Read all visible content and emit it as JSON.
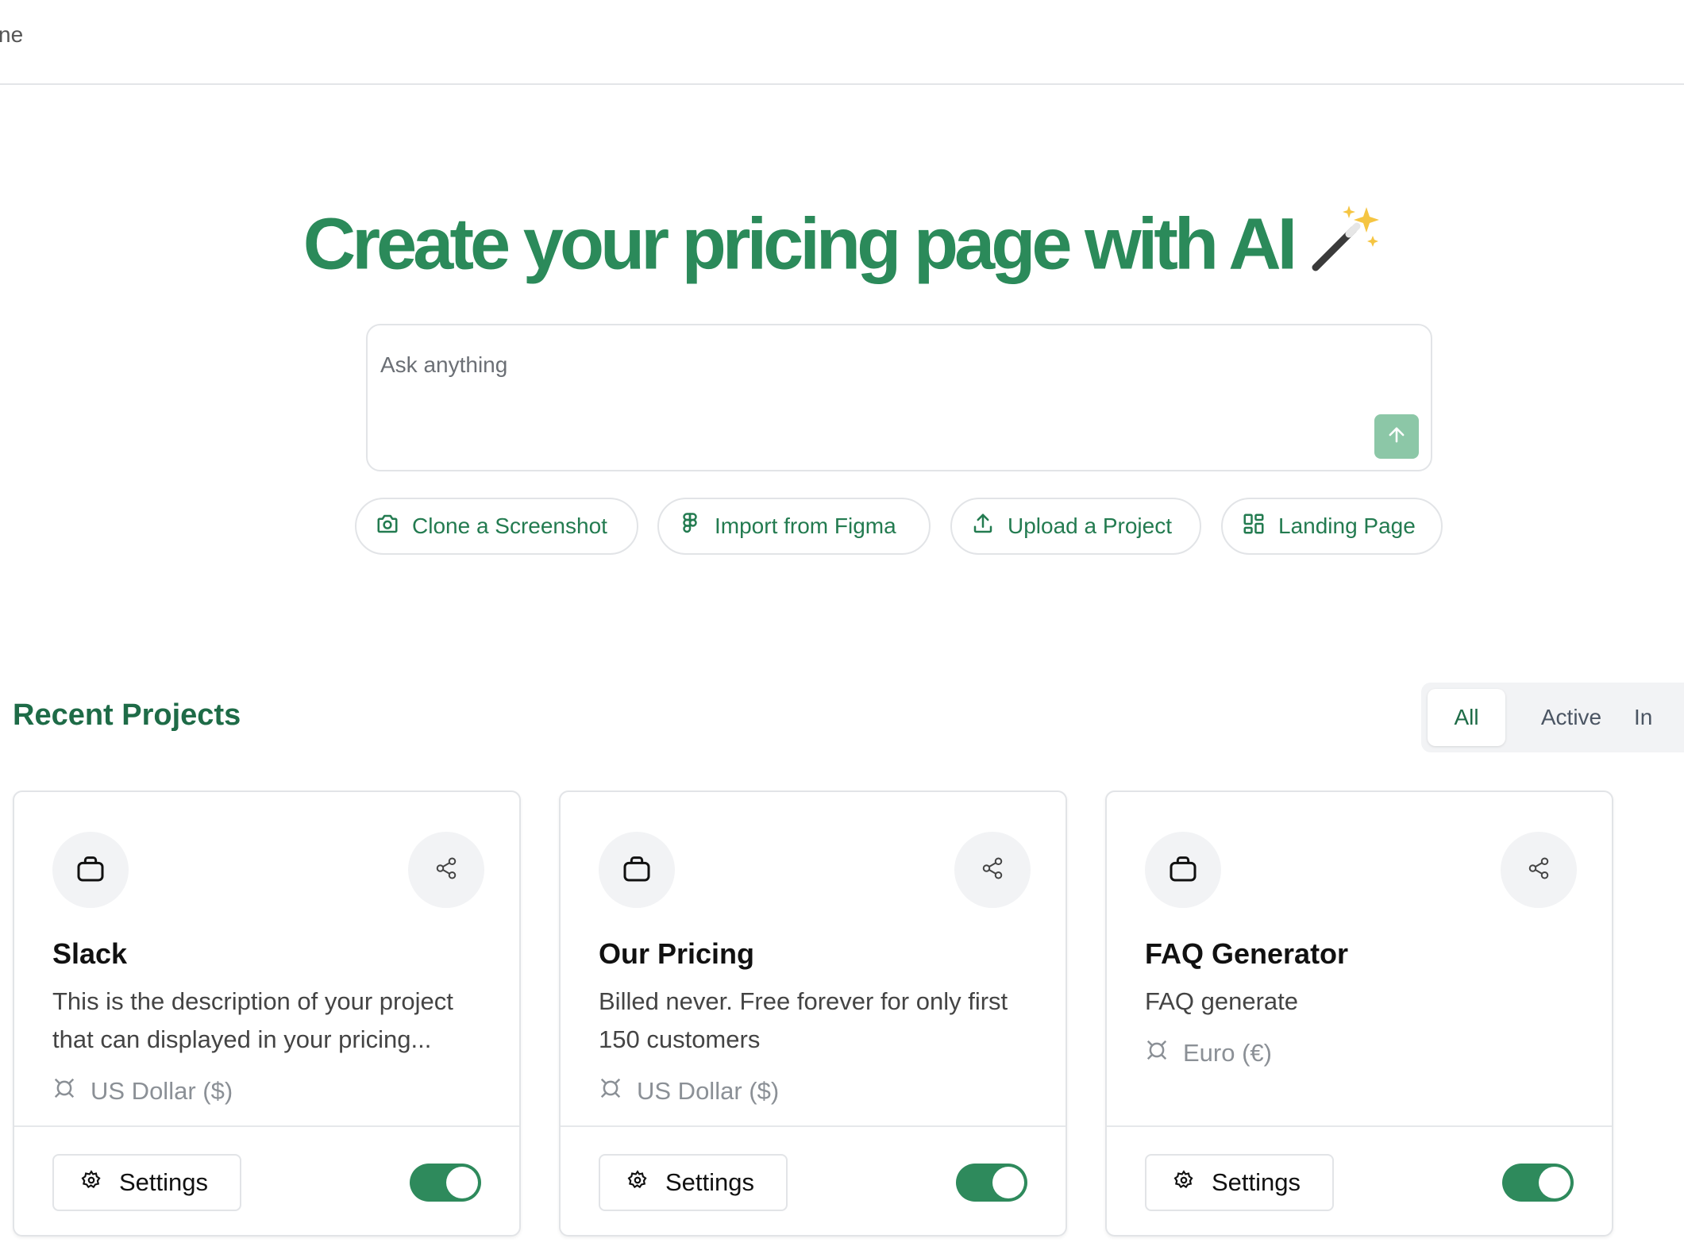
{
  "topbar": {
    "text": "ne"
  },
  "hero": {
    "title": "Create your pricing page with AI"
  },
  "prompt": {
    "placeholder": "Ask anything"
  },
  "chips": [
    {
      "label": "Clone a Screenshot",
      "icon": "camera-icon"
    },
    {
      "label": "Import from Figma",
      "icon": "figma-icon"
    },
    {
      "label": "Upload a Project",
      "icon": "upload-icon"
    },
    {
      "label": "Landing Page",
      "icon": "grid-icon"
    }
  ],
  "recent": {
    "title": "Recent Projects",
    "tabs": [
      "All",
      "Active",
      "In"
    ],
    "active_tab": "All"
  },
  "projects": [
    {
      "title": "Slack",
      "description": "This is the description of your project that can displayed in your pricing...",
      "currency": "US Dollar ($)",
      "settings_label": "Settings",
      "enabled": true
    },
    {
      "title": "Our Pricing",
      "description": "Billed never. Free forever for only first 150 customers",
      "currency": "US Dollar ($)",
      "settings_label": "Settings",
      "enabled": true
    },
    {
      "title": "FAQ Generator",
      "description": "FAQ generate",
      "currency": "Euro (€)",
      "settings_label": "Settings",
      "enabled": true
    }
  ],
  "colors": {
    "brand": "#2b8a5a",
    "brand_dark": "#1e6b47",
    "send_button": "#8cc7a7",
    "toggle_on": "#2e8a5c"
  }
}
